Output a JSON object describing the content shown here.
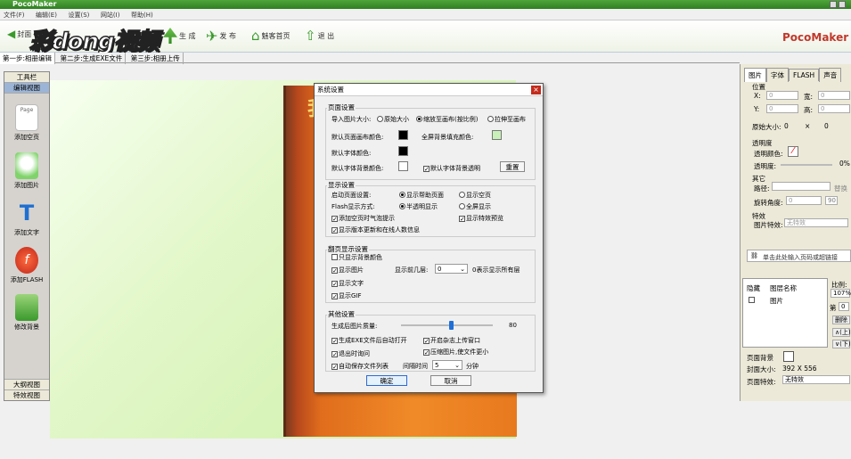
{
  "app": {
    "title": "PocoMaker"
  },
  "menu": [
    "文件(F)",
    "编辑(E)",
    "设置(S)",
    "网站(I)",
    "帮助(H)"
  ],
  "toolbar": {
    "cover": "封面",
    "brand": "彩dong视频",
    "generate": "生 成",
    "publish": "发 布",
    "home": "魅客首页",
    "exit": "退 出",
    "logo": "PocoMaker"
  },
  "steps": [
    "第一步:相册编辑",
    "第二步:生成EXE文件",
    "第三步:相册上传"
  ],
  "left": {
    "toolbox": "工具栏",
    "edit_view": "编辑视图",
    "tools": [
      "添加空页",
      "添加图片",
      "添加文字",
      "添加FLASH",
      "修改背景"
    ],
    "page_icon": "Page",
    "outline": "大纲视图",
    "effects": "特效视图"
  },
  "book": {
    "title": "我 爱"
  },
  "dialog": {
    "title": "系统设置",
    "close": "×",
    "page": {
      "title": "页面设置",
      "import_size": "导入图片大小:",
      "opt_original": "原始大小",
      "opt_scale": "缩放至画布(按比例)",
      "opt_stretch": "拉伸至画布",
      "canvas_color": "默认页面画布颜色:",
      "fullscreen_color": "全屏背景填充颜色:",
      "font_color": "默认字体颜色:",
      "font_bg": "默认字体背景颜色:",
      "font_bg_transparent": "默认字体背景透明",
      "reset": "重置"
    },
    "display": {
      "title": "显示设置",
      "startup": "启动页面设置:",
      "help_page": "显示帮助页面",
      "blank_page": "显示空页",
      "flash_mode": "Flash显示方式:",
      "semi": "半透明显示",
      "full": "全屏显示",
      "bubble": "添加空页时气泡提示",
      "effect_preview": "显示特效预览",
      "version_info": "显示版本更新和在线人数信息"
    },
    "flip": {
      "title": "翻页显示设置",
      "bg_only": "只显示背景颜色",
      "show_image": "显示图片",
      "show_layers": "显示前几层:",
      "layers_value": "0",
      "layers_note": "0表示显示所有层",
      "show_text": "显示文字",
      "show_gif": "显示GIF"
    },
    "other": {
      "title": "其他设置",
      "quality": "生成后图片质量:",
      "quality_value": "80",
      "quality_pct": 0.52,
      "auto_run": "生成EXE文件后自动打开",
      "open_upload": "开启杂志上传窗口",
      "exit_ask": "退出时询问",
      "compress": "压缩图片,使文件更小",
      "autosave": "自动保存文件列表",
      "interval": "间隔时间",
      "interval_value": "5",
      "minutes": "分钟"
    },
    "ok": "确定",
    "cancel": "取消"
  },
  "right": {
    "tabs": [
      "图片",
      "字体",
      "FLASH",
      "声音"
    ],
    "position": "位置",
    "x": "X:",
    "x_val": "0",
    "w": "宽:",
    "w_val": "0",
    "y": "Y:",
    "y_val": "0",
    "h": "高:",
    "h_val": "0",
    "orig_size": "原始大小:",
    "orig_w": "0",
    "times": "×",
    "orig_h": "0",
    "transparency": "透明度",
    "trans_color": "透明颜色:",
    "trans_level": "透明度:",
    "trans_pct": "0%",
    "other": "其它",
    "path": "路径:",
    "replace": "替换",
    "rotation": "旋转角度:",
    "rot_val": "0",
    "rot_btn": "90",
    "effect": "特效",
    "img_effect": "图片特效:",
    "no_effect": "无特效",
    "link_hint": "单击此处输入页码或超链接",
    "layer_hide": "隐藏",
    "layer_name": "图层名称",
    "layer_item": "图片",
    "scale": "比例:",
    "scale_val": "107%",
    "page_label": "第",
    "page_val": "0",
    "delete": "删除",
    "up": "∧(上)",
    "down": "∨(下)",
    "page_bg": "页面背景",
    "cover_size": "封面大小:",
    "cover_dims": "392 X 556",
    "page_effect": "页面特效:",
    "page_effect_val": "无特效"
  },
  "colors": {
    "accent": "#3a9a2c",
    "book": "#e8791e"
  }
}
